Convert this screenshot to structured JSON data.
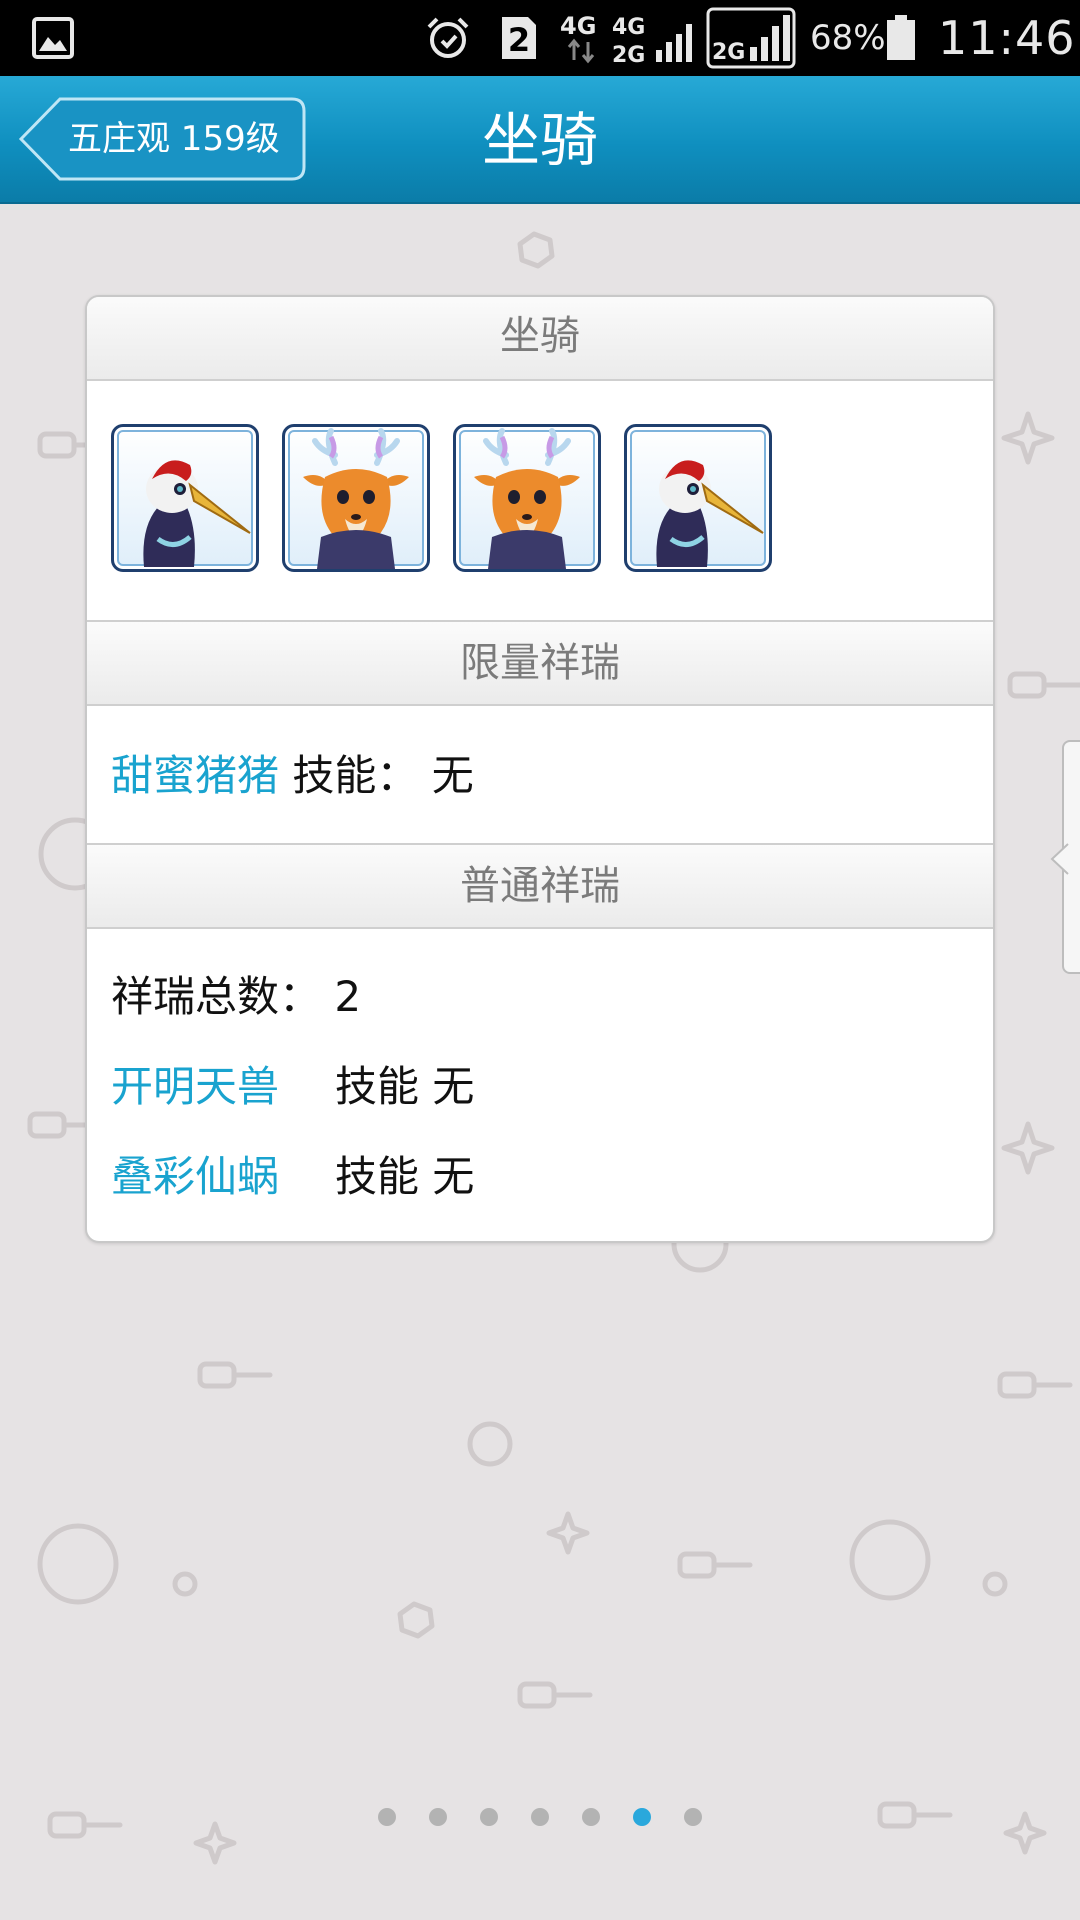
{
  "status_bar": {
    "sim_slot": "2",
    "network_1": "4G",
    "network_2_top": "4G",
    "network_2_bottom": "2G",
    "network_3": "2G",
    "battery": "68%",
    "time": "11:46",
    "icons": [
      "gallery-icon",
      "alarm-icon",
      "sim-2-icon",
      "signal-icon",
      "battery-icon"
    ]
  },
  "header": {
    "back_label": "五庄观 159级",
    "title": "坐骑",
    "color": "#1a9ccc"
  },
  "card": {
    "mounts_section": {
      "title": "坐骑",
      "icons": [
        "crane-mount-icon",
        "deer-mount-icon",
        "deer-mount-icon",
        "crane-mount-icon"
      ]
    },
    "limited_section": {
      "title": "限量祥瑞",
      "name": "甜蜜猪猪",
      "skill": "技能： 无"
    },
    "normal_section": {
      "title": "普通祥瑞",
      "total": "祥瑞总数： 2",
      "items": [
        {
          "name": "开明天兽",
          "skill": "技能 无"
        },
        {
          "name": "叠彩仙蜗",
          "skill": "技能 无"
        }
      ]
    }
  },
  "pagination": {
    "total": 7,
    "active_index": 5,
    "active_color": "#2aa8dc"
  }
}
